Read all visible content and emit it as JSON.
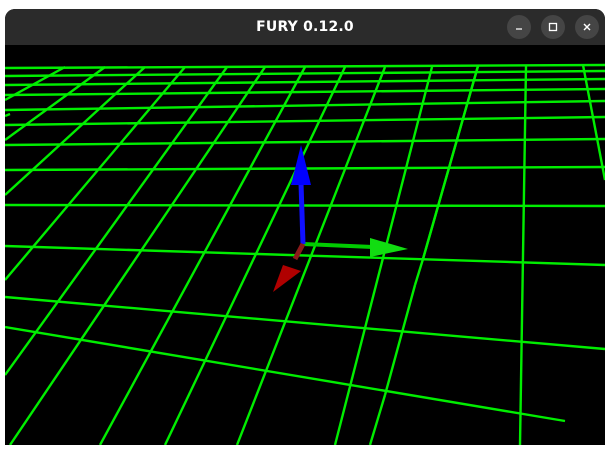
{
  "window": {
    "title": "FURY 0.12.0",
    "controls": [
      {
        "name": "minimize-button",
        "icon": "minimize-icon"
      },
      {
        "name": "maximize-button",
        "icon": "maximize-icon"
      },
      {
        "name": "close-button",
        "icon": "close-icon"
      }
    ]
  },
  "scene": {
    "background": "#000000",
    "grid_color": "#00ff00",
    "axes": [
      {
        "name": "x-axis",
        "color": "#00cc00",
        "icon": "arrow-icon"
      },
      {
        "name": "y-axis",
        "color": "#0000ff",
        "icon": "arrow-icon"
      },
      {
        "name": "z-axis",
        "color": "#aa0000",
        "icon": "arrow-icon"
      }
    ]
  }
}
